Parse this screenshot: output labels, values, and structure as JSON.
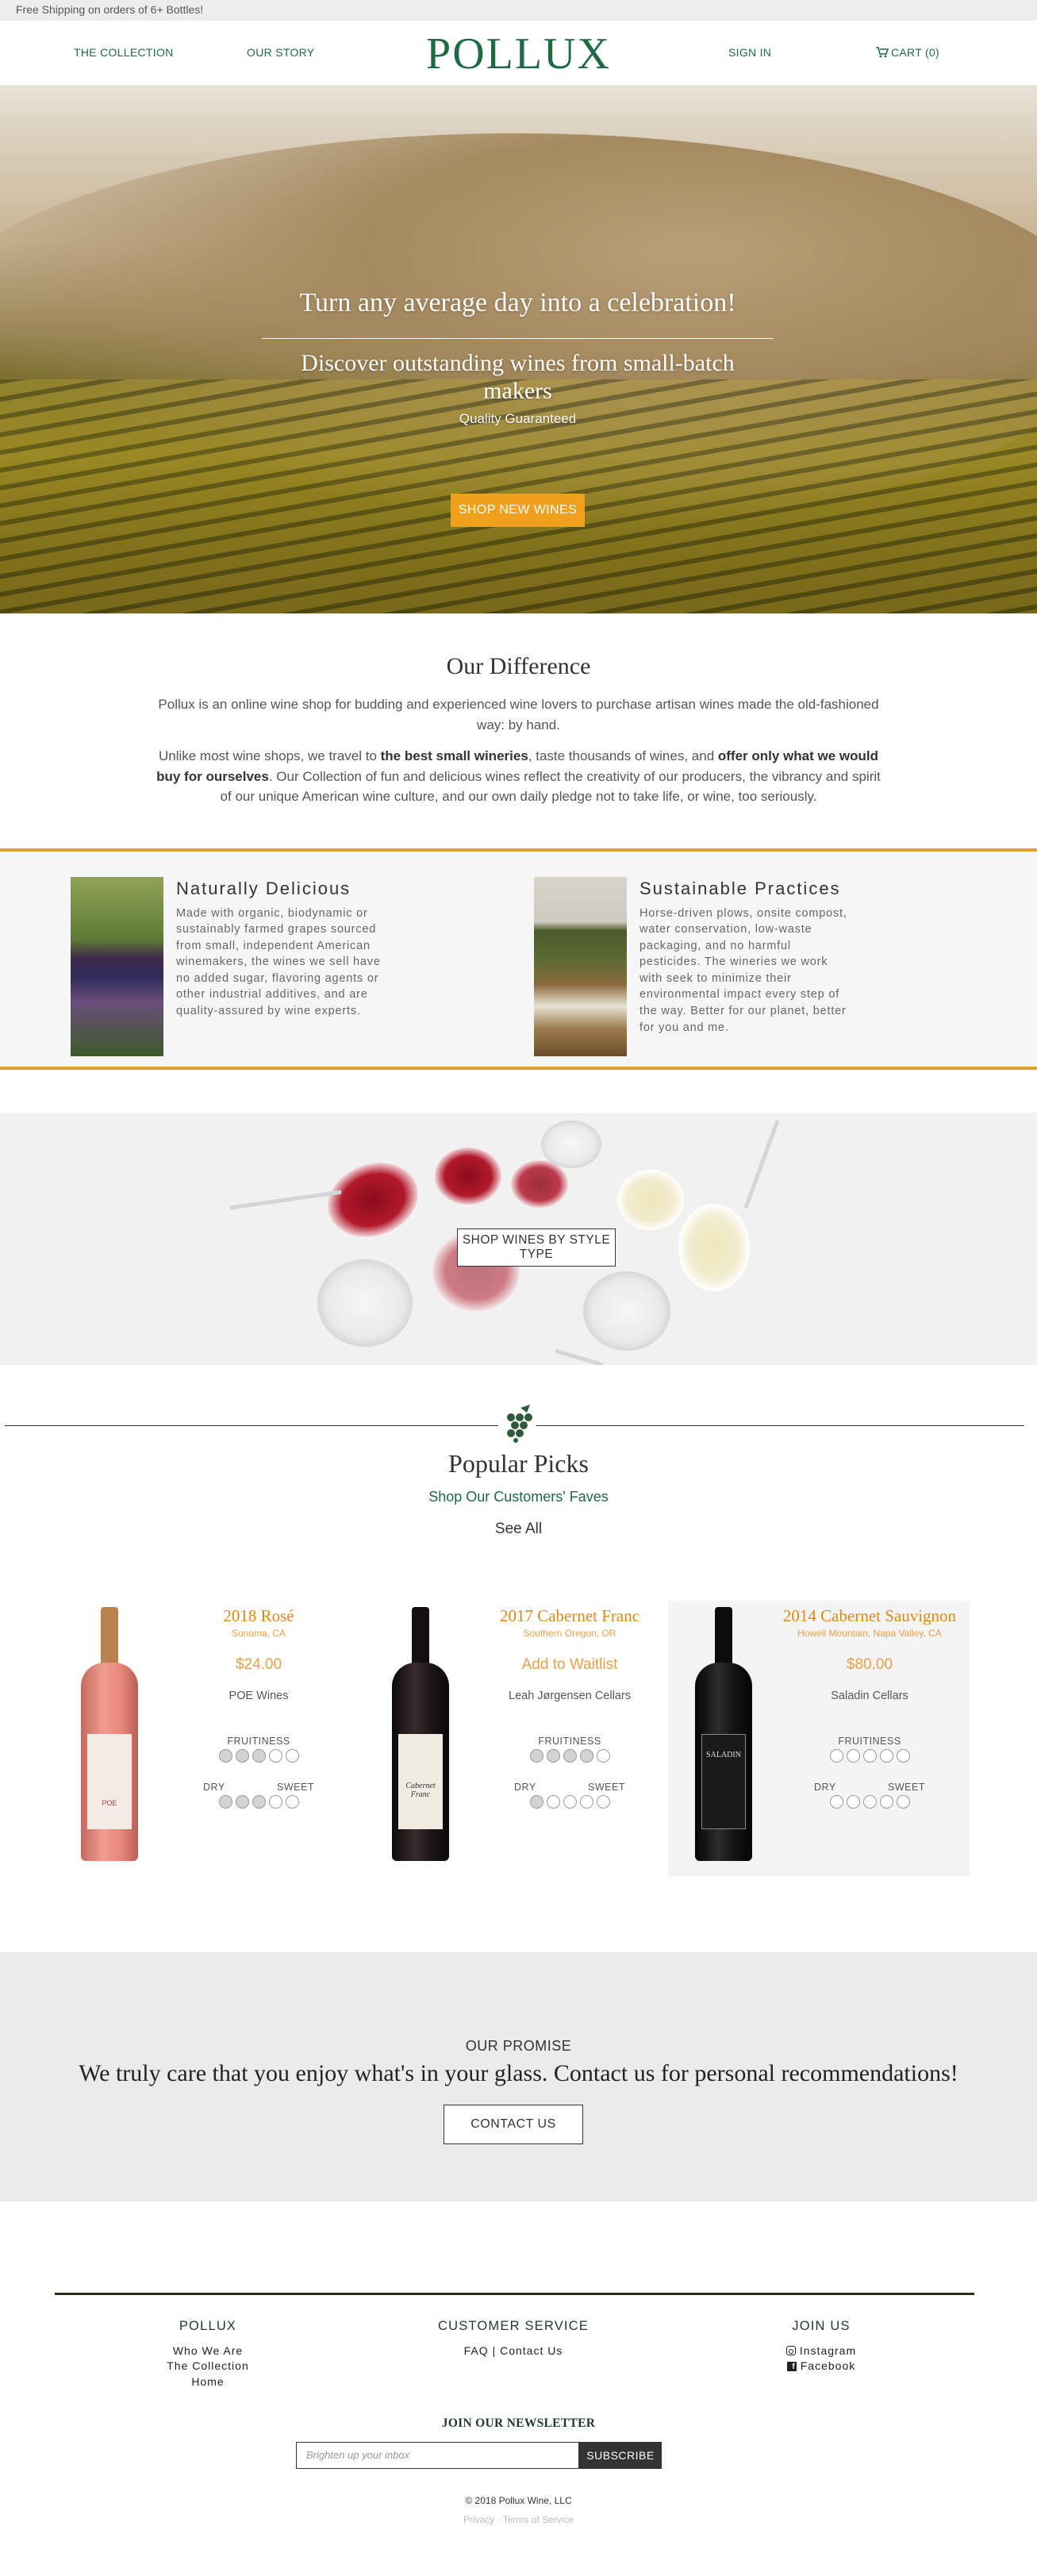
{
  "announcement": "Free Shipping on orders of 6+ Bottles!",
  "header": {
    "nav_collection": "THE COLLECTION",
    "nav_story": "OUR STORY",
    "logo": "POLLUX",
    "sign_in": "SIGN IN",
    "cart": "CART (0)"
  },
  "hero": {
    "title": "Turn any average day into a celebration!",
    "subtitle": "Discover outstanding wines from small-batch makers",
    "tagline": "Quality Guaranteed",
    "cta": "SHOP NEW WINES"
  },
  "difference": {
    "heading": "Our Difference",
    "p1": "Pollux is an online wine shop for budding and experienced wine lovers to purchase artisan wines made the old-fashioned way: by hand.",
    "p2_a": "Unlike most wine shops, we travel to ",
    "p2_b1": "the best small wineries",
    "p2_c": ", taste thousands of wines, and ",
    "p2_b2": "offer only what we would buy for ourselves",
    "p2_d": ". Our Collection of fun and delicious wines reflect the creativity of our producers, the vibrancy and spirit of our unique American wine culture, and our own daily pledge not to take life, or wine, too seriously."
  },
  "features": [
    {
      "title": "Naturally Delicious",
      "body": "Made with organic, biodynamic or sustainably farmed grapes sourced from small, independent American winemakers, the wines we sell have no added sugar, flavoring agents or other industrial additives, and are quality-assured by wine experts."
    },
    {
      "title": "Sustainable Practices",
      "body": "Horse-driven plows, onsite compost, water conservation, low-waste packaging, and no harmful pesticides. The wineries we work with seek to minimize their environmental impact every step of the way. Better for our planet, better for you and me."
    }
  ],
  "style_banner": {
    "cta": "SHOP WINES BY STYLE TYPE"
  },
  "popular": {
    "heading": "Popular Picks",
    "subheading": "Shop Our Customers' Faves",
    "see_all": "See All",
    "fruitiness_label": "FRUITINESS",
    "dry_label": "DRY",
    "sweet_label": "SWEET",
    "products": [
      {
        "name": "2018 Rosé",
        "region": "Sonoma, CA",
        "price": "$24.00",
        "maker": "POE Wines",
        "fruitiness": 3,
        "sweetness": 3,
        "bottle_color": "#e6867a",
        "label_text": "POE"
      },
      {
        "name": "2017 Cabernet Franc",
        "region": "Southern Oregon, OR",
        "price": "Add to Waitlist",
        "maker": "Leah Jørgensen Cellars",
        "fruitiness": 4,
        "sweetness": 1,
        "bottle_color": "#1b1416",
        "label_text": "Cabernet Franc"
      },
      {
        "name": "2014 Cabernet Sauvignon",
        "region": "Howell Mountain, Napa Valley, CA",
        "price": "$80.00",
        "maker": "Saladin Cellars",
        "fruitiness": 0,
        "sweetness": 0,
        "bottle_color": "#121212",
        "label_text": "SALADIN"
      }
    ]
  },
  "promise": {
    "kicker": "OUR PROMISE",
    "text": "We truly care that you enjoy what's in your glass. Contact us for personal recommendations!",
    "cta": "CONTACT US"
  },
  "footer": {
    "col1_title": "POLLUX",
    "col1_links": [
      "Who We Are",
      "The Collection",
      "Home"
    ],
    "col2_title": "CUSTOMER SERVICE",
    "col2_links": [
      "FAQ | Contact Us"
    ],
    "col3_title": "JOIN US",
    "instagram": "Instagram",
    "facebook": "Facebook",
    "newsletter_title": "JOIN OUR NEWSLETTER",
    "newsletter_placeholder": "Brighten up your inbox",
    "subscribe": "SUBSCRIBE",
    "copyright": "© 2018 Pollux Wine, LLC",
    "privacy": "Privacy",
    "terms": "Terms of Service"
  },
  "colors": {
    "brand_green": "#1f6a45",
    "accent_orange": "#f0a01c",
    "gold_rule": "#d9a326"
  }
}
